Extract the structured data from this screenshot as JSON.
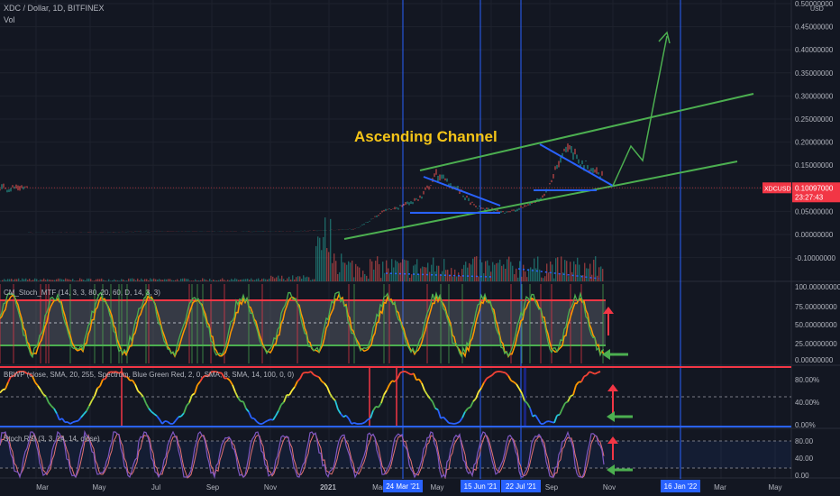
{
  "header": {
    "symbol_line": "XDC / Dollar, 1D, BITFINEX",
    "volume_label": "Vol"
  },
  "price_axis": {
    "unit": "USD",
    "ticks": [
      "0.50000000",
      "0.45000000",
      "0.40000000",
      "0.35000000",
      "0.30000000",
      "0.25000000",
      "0.20000000",
      "0.15000000",
      "0.10000000",
      "0.05000000",
      "0.00000000",
      "-0.10000000"
    ],
    "last_label": "XDCUSD",
    "last_price": "0.10097000",
    "countdown": "23:27:43",
    "last_color": "#f23645"
  },
  "annotation": {
    "text": "Ascending Channel",
    "color": "#f5c518"
  },
  "panes": {
    "stoch_mtf": {
      "title": "CM_Stoch_MTF (14, 3, 3, 80, 20, 60, D, 14, 3, 3)",
      "ticks": [
        "100.00000000",
        "75.00000000",
        "50.00000000",
        "25.00000000",
        "0.00000000"
      ]
    },
    "bbwp": {
      "title": "BBWP (close, SMA, 20, 255, Spectrum, Blue Green Red, 2, 0, SMA, 8, SMA, 14, 100, 0, 0)",
      "ticks": [
        "80.00%",
        "40.00%",
        "0.00%"
      ]
    },
    "stoch_rsi": {
      "title": "Stoch RSI (3, 3, 14, 14, close)",
      "ticks": [
        "80.00",
        "40.00",
        "0.00"
      ]
    }
  },
  "time_axis": {
    "labels": [
      "Mar",
      "May",
      "Jul",
      "Sep",
      "Nov",
      "2021",
      "Mar",
      "May",
      "Sep",
      "Nov",
      "Mar",
      "May"
    ],
    "highlighted": [
      "24 Mar '21",
      "15 Jun '21",
      "22 Jul '21",
      "16 Jan '22"
    ],
    "highlight_color": "#2962ff"
  },
  "chart_data": {
    "type": "line",
    "title": "XDC / Dollar, 1D, BITFINEX",
    "ylabel": "USD",
    "ylim": [
      -0.1,
      0.5
    ],
    "series": [
      {
        "name": "XDCUSD",
        "x": [
          "2020-02",
          "2020-04",
          "2020-06",
          "2020-08",
          "2020-10",
          "2020-12",
          "2021-01-15",
          "2021-02-15",
          "2021-03-01",
          "2021-03-24",
          "2021-04-10",
          "2021-05-01",
          "2021-05-20",
          "2021-06-15",
          "2021-07-01",
          "2021-07-22",
          "2021-08-05",
          "2021-08-25",
          "2021-09-10",
          "2021-10-01",
          "2021-10-20",
          "2021-11-01"
        ],
        "values": [
          0.004,
          0.005,
          0.006,
          0.007,
          0.006,
          0.008,
          0.012,
          0.05,
          0.06,
          0.08,
          0.13,
          0.1,
          0.06,
          0.05,
          0.05,
          0.07,
          0.09,
          0.19,
          0.16,
          0.13,
          0.11,
          0.101
        ]
      }
    ],
    "annotations": [
      "Ascending Channel"
    ]
  }
}
